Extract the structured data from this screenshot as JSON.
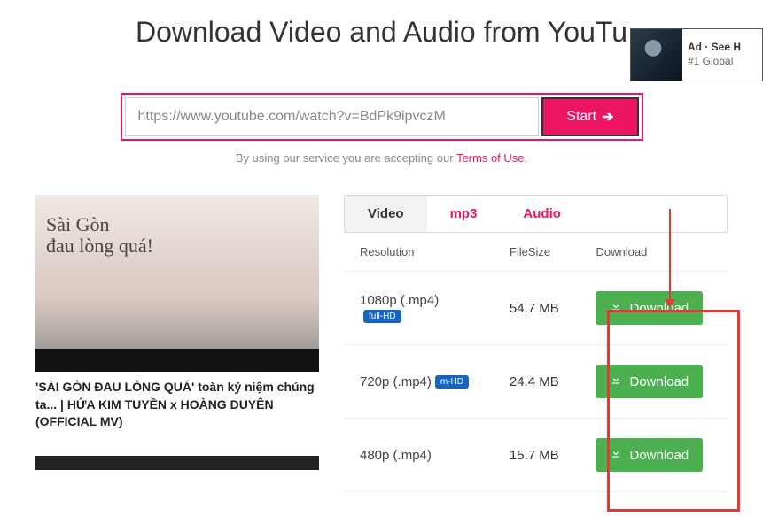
{
  "page_title": "Download Video and Audio from YouTu",
  "ad": {
    "line1": "Ad · See H",
    "line2": "#1 Global"
  },
  "search": {
    "url_value": "https://www.youtube.com/watch?v=BdPk9ipvczM",
    "start_label": "Start"
  },
  "terms": {
    "prefix": "By using our service you are accepting our ",
    "link": "Terms of Use",
    "suffix": "."
  },
  "video": {
    "overlay": "Sài Gòn\nđau lòng quá!",
    "title": "'SÀI GÒN ĐAU LÒNG QUÁ' toàn kỷ niệm chúng ta... | HỨA KIM TUYỀN x HOÀNG DUYÊN (OFFICIAL MV)"
  },
  "tabs": [
    {
      "label": "Video",
      "active": true
    },
    {
      "label": "mp3",
      "active": false
    },
    {
      "label": "Audio",
      "active": false
    }
  ],
  "table": {
    "headers": {
      "resolution": "Resolution",
      "filesize": "FileSize",
      "download": "Download"
    },
    "rows": [
      {
        "res": "1080p (.mp4)",
        "badge": "full-HD",
        "badge_class": "fullhd",
        "size": "54.7 MB",
        "dl": "Download"
      },
      {
        "res": "720p (.mp4)",
        "badge": "m-HD",
        "badge_class": "mhd",
        "size": "24.4 MB",
        "dl": "Download"
      },
      {
        "res": "480p (.mp4)",
        "badge": "",
        "badge_class": "",
        "size": "15.7 MB",
        "dl": "Download"
      }
    ]
  }
}
